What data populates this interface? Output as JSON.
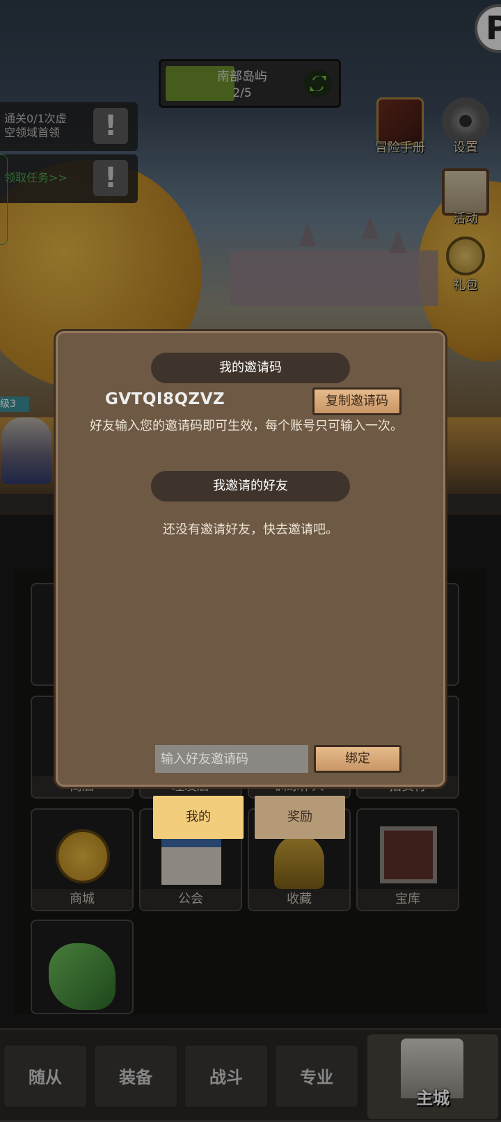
{
  "region": {
    "name": "南部岛屿",
    "progress_text": "2/5",
    "progress_fraction": 0.4
  },
  "quests": [
    {
      "text_line1": "通关0/1次虚",
      "text_line2": "空领域首领",
      "alert": "!"
    },
    {
      "text": "领取任务>>",
      "alert": "!"
    }
  ],
  "right_menu": {
    "adventure_handbook": "冒险手册",
    "settings": "设置",
    "events": "活动",
    "gift_pack": "礼包"
  },
  "hero_level_text": "级3",
  "buildings": {
    "row_partial": [
      "商店",
      "理发店",
      "训练仆人",
      "拍卖行"
    ],
    "mall": "商城",
    "guild": "公会",
    "collection": "收藏",
    "treasury": "宝库"
  },
  "bottom_nav": {
    "followers": "随从",
    "equipment": "装备",
    "battle": "战斗",
    "profession": "专业",
    "main_city": "主城"
  },
  "invite_modal": {
    "my_code_title": "我的邀请码",
    "invite_code": "GVTQI8QZVZ",
    "copy_button": "复制邀请码",
    "hint": "好友输入您的邀请码即可生效，每个账号只可输入一次。",
    "my_friends_title": "我邀请的好友",
    "empty_text": "还没有邀请好友，快去邀请吧。",
    "input_placeholder": "输入好友邀请码",
    "bind_button": "绑定"
  },
  "modal_tabs": {
    "mine": "我的",
    "rewards": "奖励",
    "active": "mine"
  },
  "colors": {
    "modal_bg": "#6e5944",
    "tab_active": "#f2cd7b",
    "tab_inactive": "#b59a78",
    "progress_fill": "#6b8e2d"
  }
}
